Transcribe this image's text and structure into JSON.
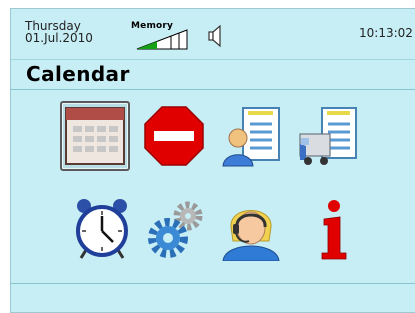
{
  "status": {
    "day": "Thursday",
    "date": "01.Jul.2010",
    "memory_label": "Memory",
    "memory_level": 0.4,
    "time": "10:13:02"
  },
  "header": {
    "title": "Calendar"
  },
  "apps": [
    {
      "icon": "calendar-icon",
      "selected": true
    },
    {
      "icon": "stop-sign-icon",
      "selected": false
    },
    {
      "icon": "contacts-document-icon",
      "selected": false
    },
    {
      "icon": "vehicle-document-icon",
      "selected": false
    },
    {
      "icon": "alarm-clock-icon",
      "selected": false
    },
    {
      "icon": "settings-gears-icon",
      "selected": false
    },
    {
      "icon": "operator-headset-icon",
      "selected": false
    },
    {
      "icon": "info-icon",
      "selected": false
    }
  ],
  "colors": {
    "background": "#c8eef5",
    "accent": "#e00000"
  }
}
